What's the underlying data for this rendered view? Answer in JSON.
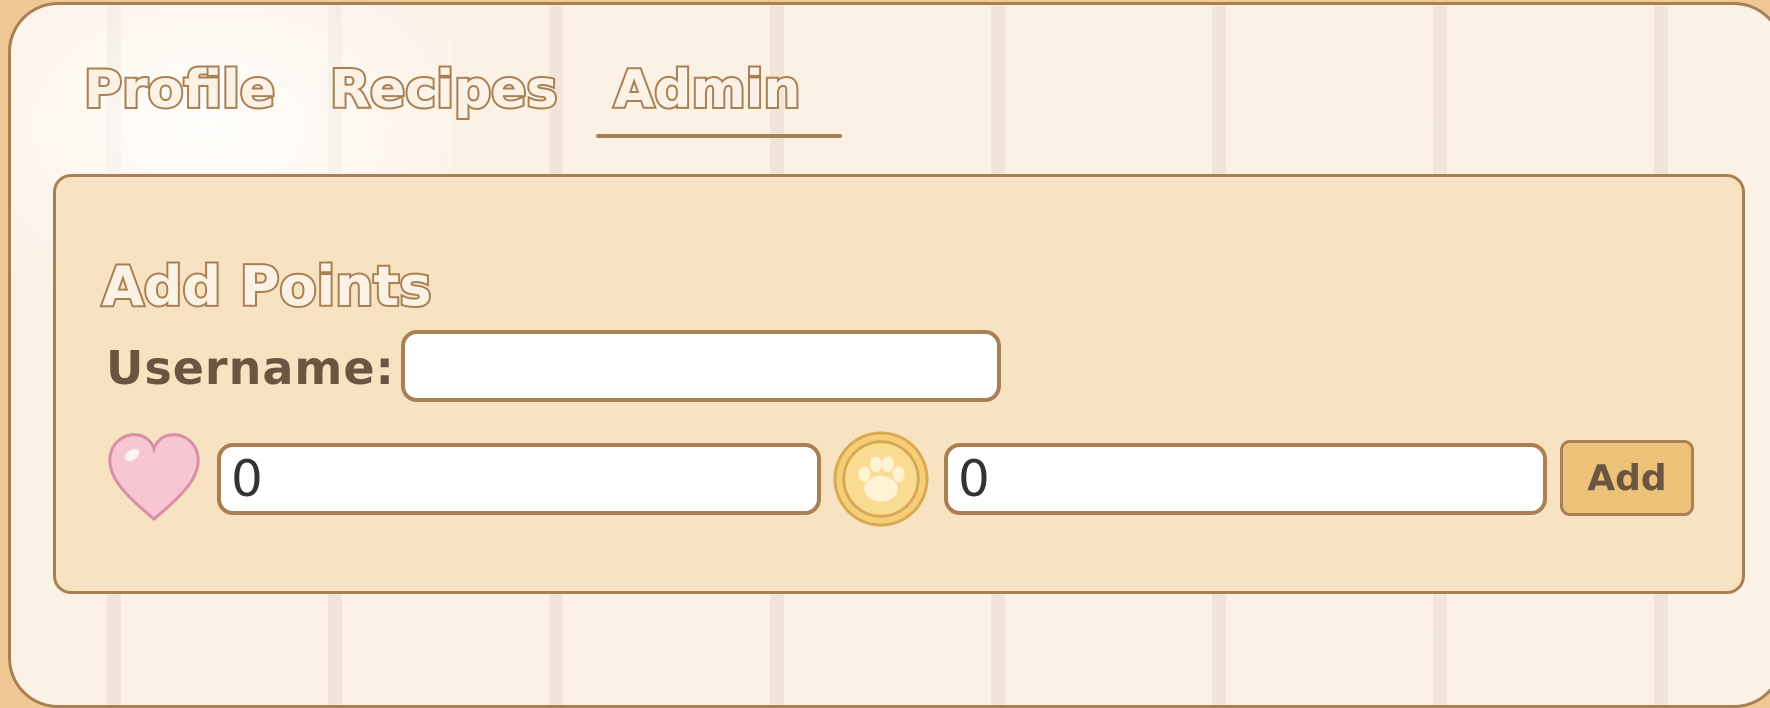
{
  "tabs": {
    "profile_label": "Profile",
    "recipes_label": "Recipes",
    "admin_label": "Admin",
    "active": "Admin"
  },
  "add_points": {
    "title": "Add Points",
    "username_label": "Username:",
    "username_value": "",
    "heart_value": "0",
    "coin_value": "0",
    "add_button_label": "Add"
  },
  "icons": {
    "heart": "heart-icon",
    "coin": "paw-coin-icon"
  },
  "colors": {
    "outline": "#a98054",
    "panel_bg": "#f7e3c2",
    "page_bg": "#fbf1e4",
    "button_bg": "#ebc278",
    "label_text": "#6b5540",
    "heart_pink": "#f6c6d3",
    "coin_gold": "#f4cf78"
  }
}
